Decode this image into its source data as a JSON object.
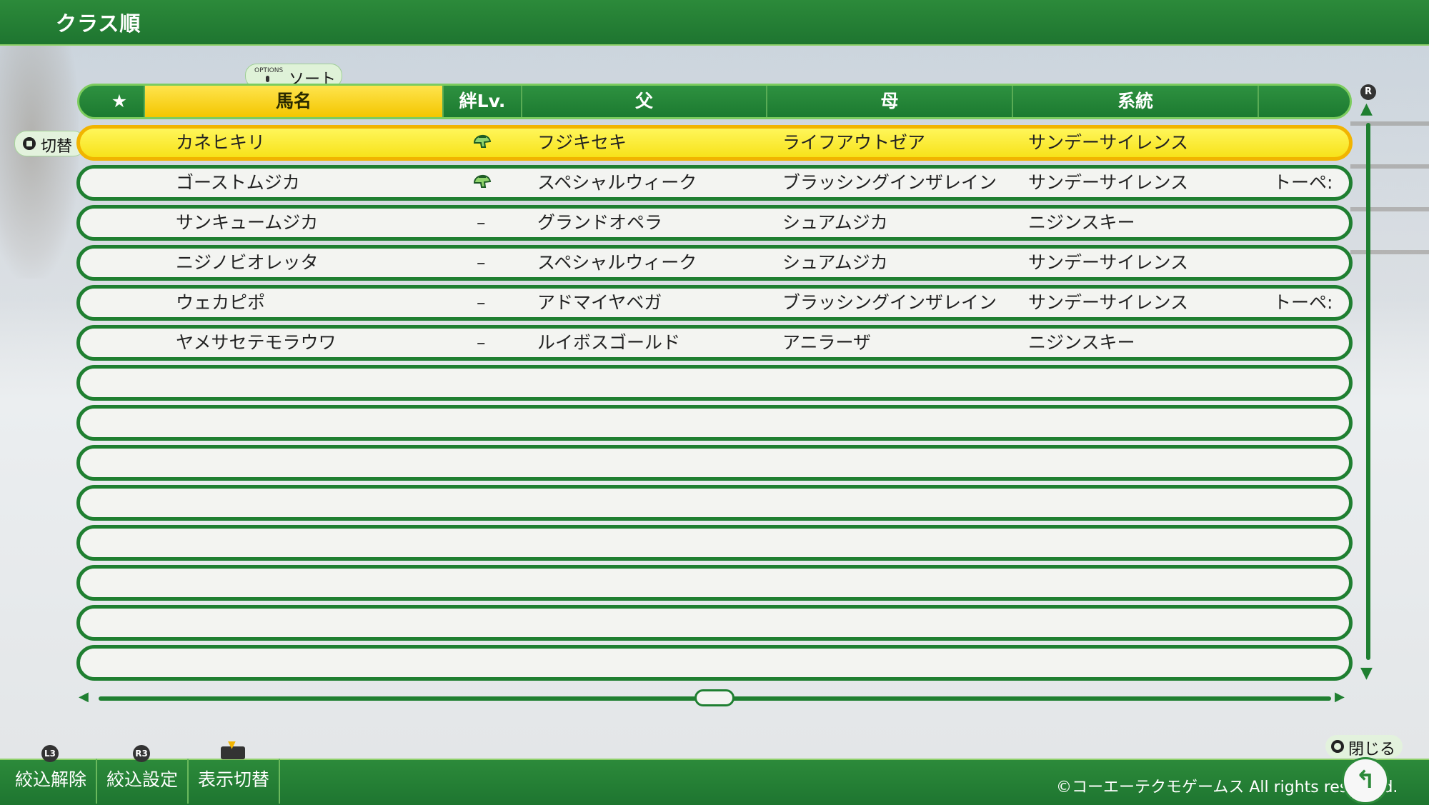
{
  "header": {
    "title": "クラス順"
  },
  "sort_button": {
    "badge": "OPTIONS",
    "label": "ソート"
  },
  "switch_button": {
    "label": "切替"
  },
  "columns": [
    {
      "label": "★"
    },
    {
      "label": "馬名"
    },
    {
      "label": "絆Lv."
    },
    {
      "label": "父"
    },
    {
      "label": "母"
    },
    {
      "label": "系統"
    },
    {
      "label": ""
    }
  ],
  "rows": [
    {
      "name": "カネヒキリ",
      "bond": "helmet-icon",
      "sire": "フジキセキ",
      "dam": "ライフアウトゼア",
      "line": "サンデーサイレンス",
      "extra": ""
    },
    {
      "name": "ゴーストムジカ",
      "bond": "helmet-icon",
      "sire": "スペシャルウィーク",
      "dam": "ブラッシングインザレイン",
      "line": "サンデーサイレンス",
      "extra": "トーペ:"
    },
    {
      "name": "サンキュームジカ",
      "bond": "–",
      "sire": "グランドオペラ",
      "dam": "シュアムジカ",
      "line": "ニジンスキー",
      "extra": ""
    },
    {
      "name": "ニジノビオレッタ",
      "bond": "–",
      "sire": "スペシャルウィーク",
      "dam": "シュアムジカ",
      "line": "サンデーサイレンス",
      "extra": ""
    },
    {
      "name": "ウェカピポ",
      "bond": "–",
      "sire": "アドマイヤベガ",
      "dam": "ブラッシングインザレイン",
      "line": "サンデーサイレンス",
      "extra": "トーペ:"
    },
    {
      "name": "ヤメサセテモラウワ",
      "bond": "–",
      "sire": "ルイボスゴールド",
      "dam": "アニラーザ",
      "line": "ニジンスキー",
      "extra": ""
    }
  ],
  "footer": {
    "buttons": [
      {
        "badge": "L3",
        "label": "絞込解除"
      },
      {
        "badge": "R3",
        "label": "絞込設定"
      },
      {
        "badge": "",
        "label": "表示切替"
      }
    ],
    "close_label": "閉じる",
    "copyright": "©コーエーテクモゲームス All rights reserved.",
    "r_badge": "R"
  },
  "colors": {
    "accent_green": "#1f7f31",
    "highlight_yellow": "#f7e21a"
  }
}
